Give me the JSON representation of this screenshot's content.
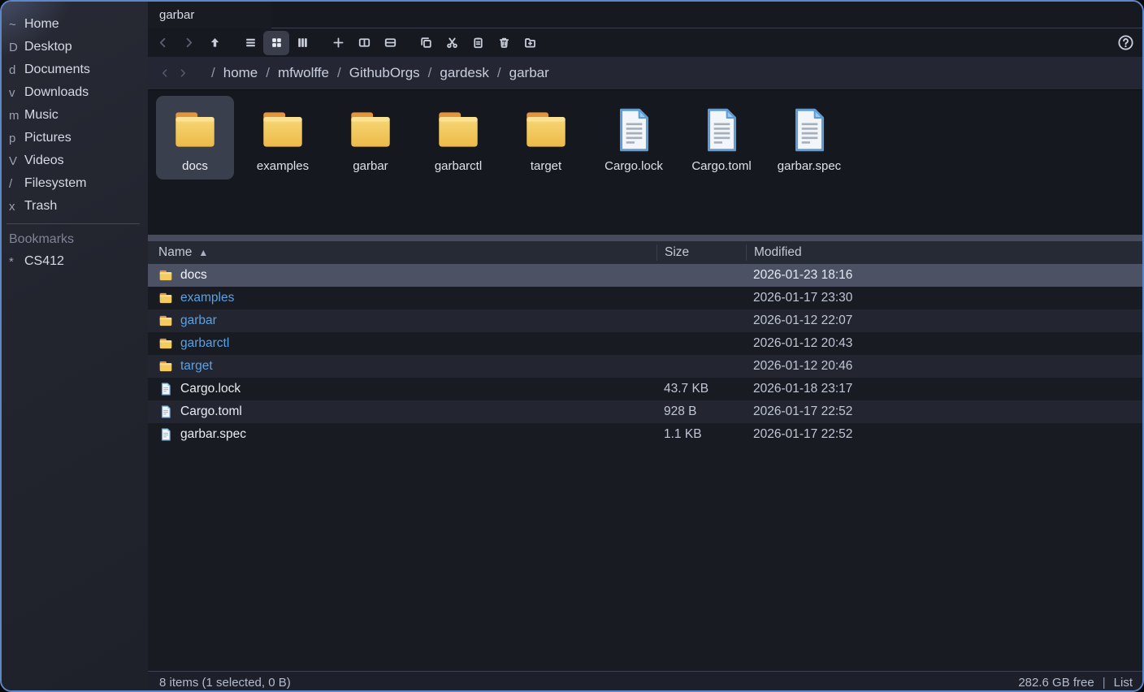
{
  "window": {
    "tab_title": "garbar",
    "accent_color": "#5d87c6",
    "folder_color": "#f3cb5f",
    "selection_color": "#4c5164",
    "link_color": "#5ca1e1"
  },
  "sidebar": {
    "places": [
      {
        "glyph": "~",
        "label": "Home"
      },
      {
        "glyph": "D",
        "label": "Desktop"
      },
      {
        "glyph": "d",
        "label": "Documents"
      },
      {
        "glyph": "v",
        "label": "Downloads"
      },
      {
        "glyph": "m",
        "label": "Music"
      },
      {
        "glyph": "p",
        "label": "Pictures"
      },
      {
        "glyph": "V",
        "label": "Videos"
      },
      {
        "glyph": "/",
        "label": "Filesystem"
      },
      {
        "glyph": "x",
        "label": "Trash"
      }
    ],
    "bookmarks_header": "Bookmarks",
    "bookmarks": [
      {
        "glyph": "*",
        "label": "CS412"
      }
    ]
  },
  "toolbar": {
    "buttons": [
      {
        "icon": "chevron-left-icon",
        "name": "back-button",
        "state": "dim"
      },
      {
        "icon": "chevron-right-icon",
        "name": "forward-button",
        "state": "dim"
      },
      {
        "icon": "arrow-up-icon",
        "name": "up-button",
        "state": ""
      },
      {
        "icon": "view-list-icon",
        "name": "view-list-button",
        "state": "gap"
      },
      {
        "icon": "view-grid-icon",
        "name": "view-grid-button",
        "state": "active"
      },
      {
        "icon": "view-columns-icon",
        "name": "view-columns-button",
        "state": ""
      },
      {
        "icon": "plus-icon",
        "name": "new-tab-button",
        "state": "gap"
      },
      {
        "icon": "split-horizontal-icon",
        "name": "split-horizontal-button",
        "state": ""
      },
      {
        "icon": "split-vertical-icon",
        "name": "split-vertical-button",
        "state": ""
      },
      {
        "icon": "copy-icon",
        "name": "copy-button",
        "state": "gap"
      },
      {
        "icon": "cut-icon",
        "name": "cut-button",
        "state": ""
      },
      {
        "icon": "paste-icon",
        "name": "paste-button",
        "state": ""
      },
      {
        "icon": "trash-icon",
        "name": "delete-button",
        "state": ""
      },
      {
        "icon": "new-folder-icon",
        "name": "new-folder-button",
        "state": ""
      }
    ],
    "help_icon": "help-icon"
  },
  "breadcrumb": {
    "separator": "/",
    "segments": [
      "home",
      "mfwolffe",
      "GithubOrgs",
      "gardesk",
      "garbar"
    ]
  },
  "grid": {
    "items": [
      {
        "name": "docs",
        "type": "folder",
        "selected": true
      },
      {
        "name": "examples",
        "type": "folder",
        "selected": false
      },
      {
        "name": "garbar",
        "type": "folder",
        "selected": false
      },
      {
        "name": "garbarctl",
        "type": "folder",
        "selected": false
      },
      {
        "name": "target",
        "type": "folder",
        "selected": false
      },
      {
        "name": "Cargo.lock",
        "type": "file",
        "selected": false
      },
      {
        "name": "Cargo.toml",
        "type": "file",
        "selected": false
      },
      {
        "name": "garbar.spec",
        "type": "file",
        "selected": false
      }
    ]
  },
  "list": {
    "columns": {
      "name": "Name",
      "size": "Size",
      "modified": "Modified"
    },
    "sort_indicator": "▲",
    "rows": [
      {
        "name": "docs",
        "type": "folder",
        "size": "",
        "modified": "2026-01-23 18:16",
        "selected": true
      },
      {
        "name": "examples",
        "type": "folder",
        "size": "",
        "modified": "2026-01-17 23:30",
        "selected": false
      },
      {
        "name": "garbar",
        "type": "folder",
        "size": "",
        "modified": "2026-01-12 22:07",
        "selected": false
      },
      {
        "name": "garbarctl",
        "type": "folder",
        "size": "",
        "modified": "2026-01-12 20:43",
        "selected": false
      },
      {
        "name": "target",
        "type": "folder",
        "size": "",
        "modified": "2026-01-12 20:46",
        "selected": false
      },
      {
        "name": "Cargo.lock",
        "type": "file",
        "size": "43.7 KB",
        "modified": "2026-01-18 23:17",
        "selected": false
      },
      {
        "name": "Cargo.toml",
        "type": "file",
        "size": "928 B",
        "modified": "2026-01-17 22:52",
        "selected": false
      },
      {
        "name": "garbar.spec",
        "type": "file",
        "size": "1.1 KB",
        "modified": "2026-01-17 22:52",
        "selected": false
      }
    ]
  },
  "statusbar": {
    "items_text": "8 items (1 selected, 0 B)",
    "free_space": "282.6 GB free",
    "separator": "|",
    "view_mode": "List"
  }
}
